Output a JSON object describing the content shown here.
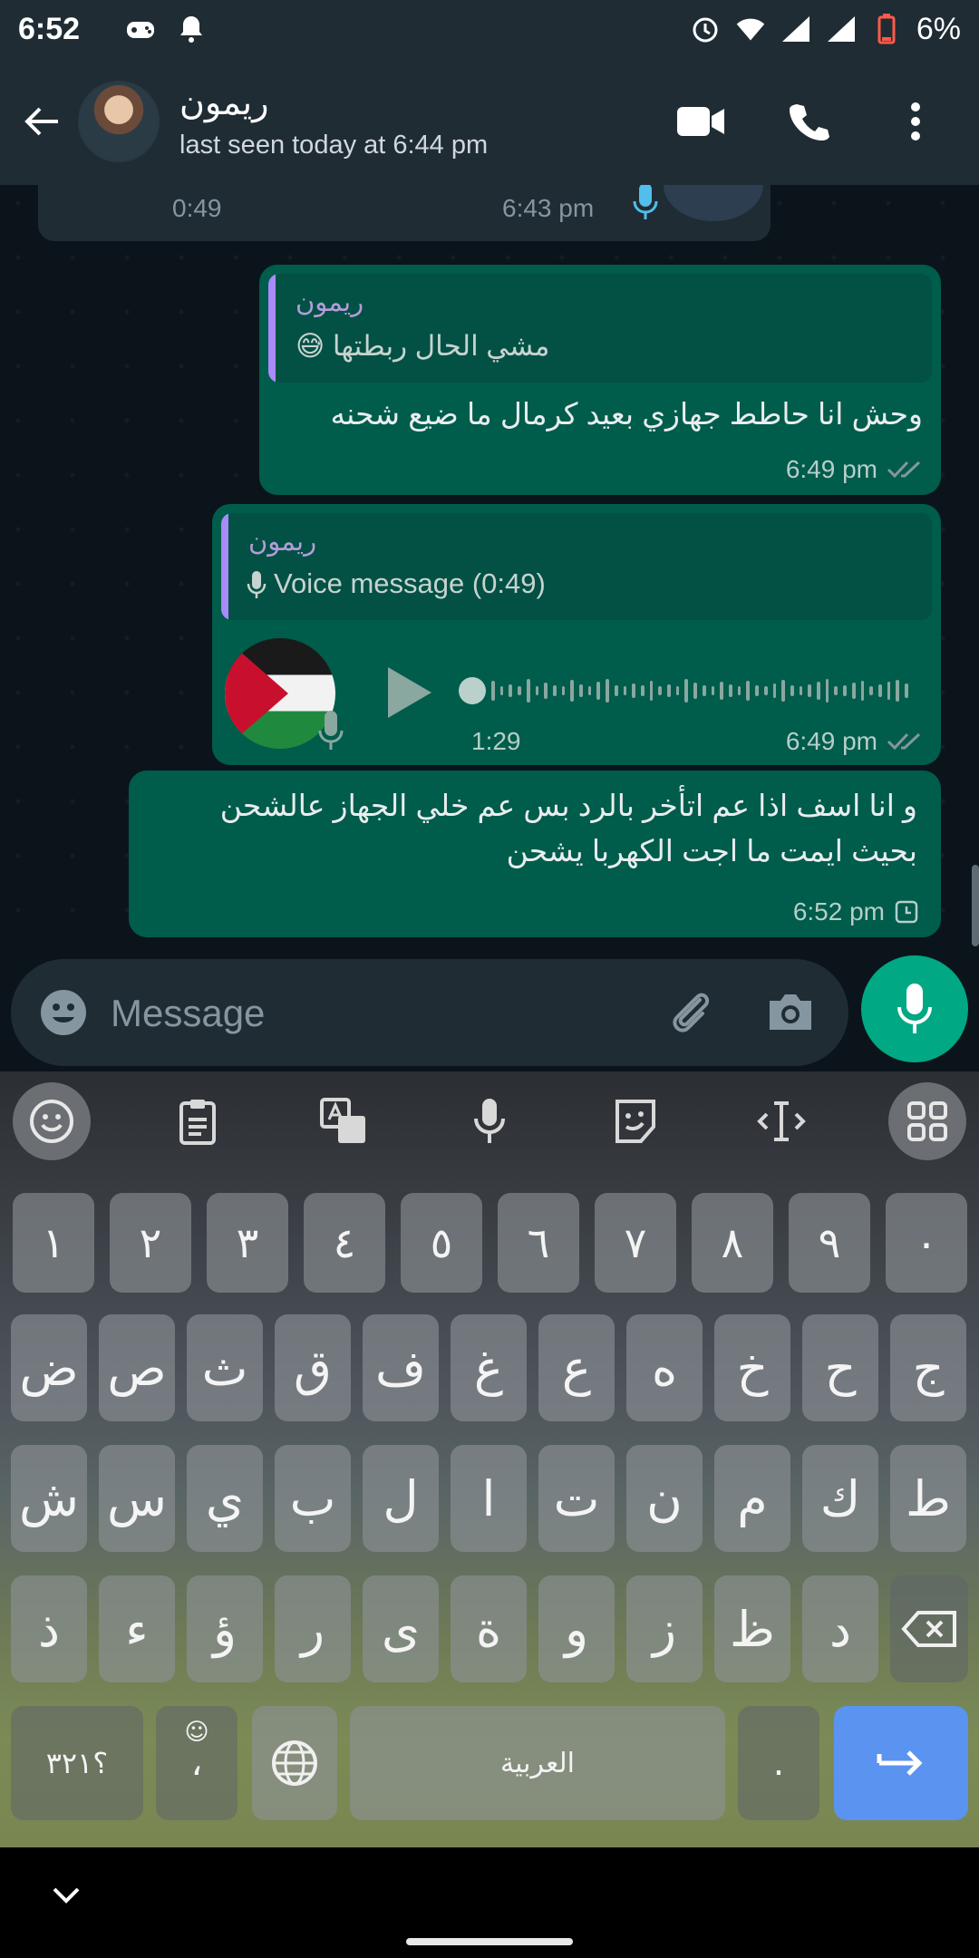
{
  "status_bar": {
    "time": "6:52",
    "battery": "6%"
  },
  "header": {
    "contact_name": "ريمون",
    "last_seen": "last seen today at 6:44 pm"
  },
  "messages": {
    "partial_incoming": {
      "duration": "0:49",
      "time": "6:43 pm"
    },
    "reply1": {
      "quote_name": "ريمون",
      "quote_text": "مشي الحال ربطتها 😅",
      "text": "وحش انا حاطط جهازي بعيد كرمال ما ضيع شحنه",
      "time": "6:49 pm"
    },
    "reply2": {
      "quote_name": "ريمون",
      "quote_text": "Voice message (0:49)",
      "voice_duration": "1:29",
      "voice_progress": 0,
      "time": "6:49 pm"
    },
    "msg3": {
      "line1": "و انا اسف اذا عم اتأخر بالرد بس عم خلي الجهاز عالشحن",
      "line2": "بحيث ايمت ما اجت الكهربا يشحن",
      "time": "6:52 pm"
    }
  },
  "composer": {
    "placeholder": "Message"
  },
  "keyboard": {
    "numbers": [
      "١",
      "٢",
      "٣",
      "٤",
      "٥",
      "٦",
      "٧",
      "٨",
      "٩",
      "٠"
    ],
    "row1": [
      "ض",
      "ص",
      "ث",
      "ق",
      "ف",
      "غ",
      "ع",
      "ه",
      "خ",
      "ح",
      "ج"
    ],
    "row2": [
      "ش",
      "س",
      "ي",
      "ب",
      "ل",
      "ا",
      "ت",
      "ن",
      "م",
      "ك",
      "ط"
    ],
    "row3": [
      "ذ",
      "ء",
      "ؤ",
      "ر",
      "ى",
      "ة",
      "و",
      "ز",
      "ظ",
      "د"
    ],
    "symbols_label": "؟٣٢١",
    "comma_label": "،",
    "space_label": "العربية",
    "period_label": "."
  },
  "colors": {
    "outgoing_bubble": "#005c4b",
    "accent": "#00a884",
    "enter_key": "#5b93f0"
  }
}
